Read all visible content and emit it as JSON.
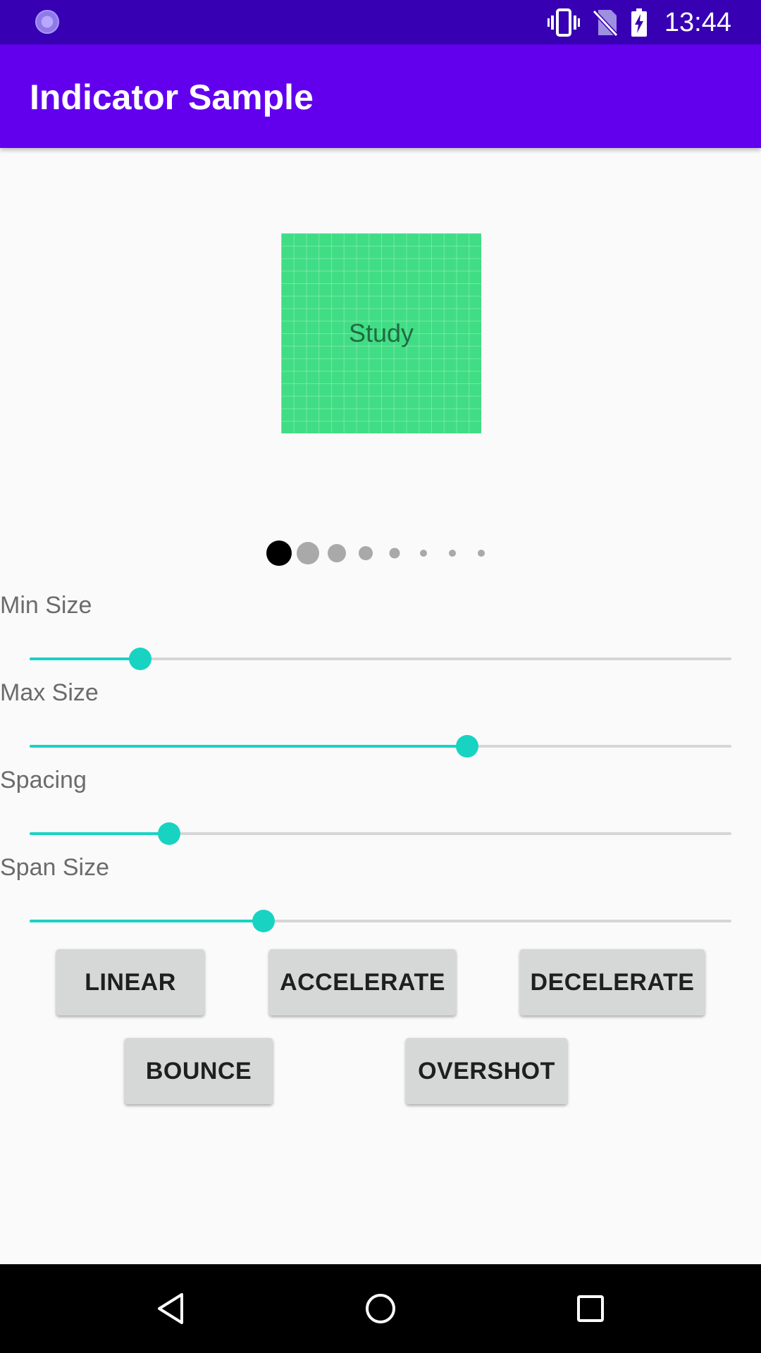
{
  "status_bar": {
    "time": "13:44",
    "icons": [
      "loading-icon",
      "vibrate-icon",
      "no-sim-icon",
      "battery-charging-icon"
    ]
  },
  "app_bar": {
    "title": "Indicator Sample"
  },
  "pager": {
    "card_label": "Study",
    "card_color": "#40dd84",
    "indicator": {
      "total": 8,
      "selected_index": 0,
      "selected_color": "#000000",
      "unselected_color": "#a9a9a9"
    }
  },
  "sliders": [
    {
      "label": "Min Size",
      "value": 0.158
    },
    {
      "label": "Max Size",
      "value": 0.623
    },
    {
      "label": "Spacing",
      "value": 0.199
    },
    {
      "label": "Span Size",
      "value": 0.333
    }
  ],
  "accent_color": "#18d3c2",
  "buttons": {
    "linear": "LINEAR",
    "accelerate": "ACCELERATE",
    "decelerate": "DECELERATE",
    "bounce": "BOUNCE",
    "overshot": "OVERSHOT"
  },
  "nav_bar": {
    "icons": [
      "back-icon",
      "home-icon",
      "recents-icon"
    ]
  }
}
